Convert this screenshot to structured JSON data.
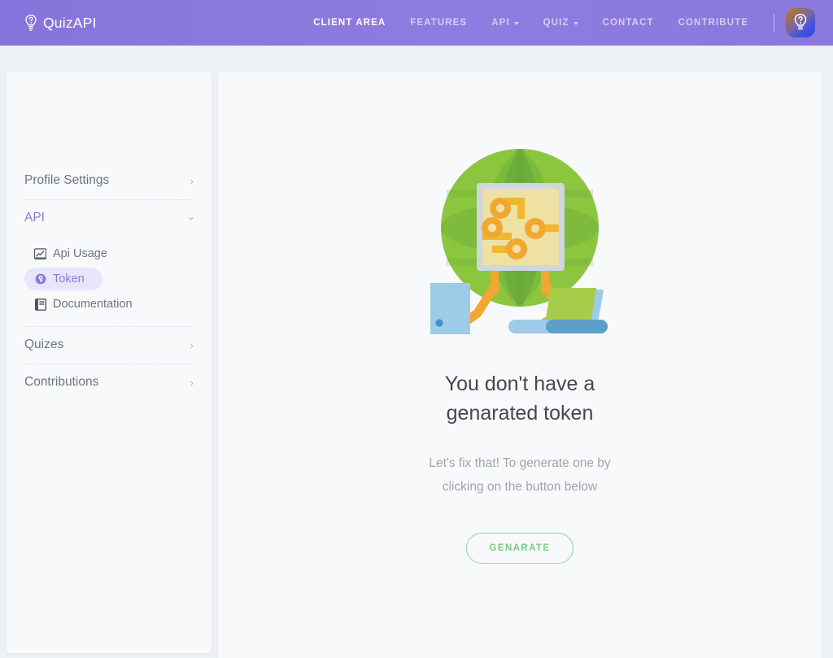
{
  "navbar": {
    "brand": "QuizAPI",
    "brand_icon": "lightbulb-question-icon",
    "avatar_icon": "lightbulb-question-icon",
    "links": [
      {
        "label": "CLIENT AREA",
        "active": true,
        "caret": false,
        "name": "nav-link-client-area"
      },
      {
        "label": "FEATURES",
        "active": false,
        "caret": false,
        "name": "nav-link-features"
      },
      {
        "label": "API",
        "active": false,
        "caret": true,
        "name": "nav-link-api"
      },
      {
        "label": "QUIZ",
        "active": false,
        "caret": true,
        "name": "nav-link-quiz"
      },
      {
        "label": "CONTACT",
        "active": false,
        "caret": false,
        "name": "nav-link-contact"
      },
      {
        "label": "CONTRIBUTE",
        "active": false,
        "caret": false,
        "name": "nav-link-contribute"
      }
    ],
    "brand_color": "#8a78dd",
    "active_link_color": "#ffffff",
    "inactive_link_color": "rgba(255,255,255,0.62)"
  },
  "sidebar": {
    "items": [
      {
        "label": "Profile Settings",
        "state": "collapsed",
        "chevron": "chevron-right-icon"
      },
      {
        "label": "API",
        "state": "expanded",
        "chevron": "chevron-down-icon"
      },
      {
        "label": "Quizes",
        "state": "collapsed",
        "chevron": "chevron-right-icon"
      },
      {
        "label": "Contributions",
        "state": "collapsed",
        "chevron": "chevron-right-icon"
      }
    ],
    "subitems": [
      {
        "label": "Api Usage",
        "icon": "chart-line-icon",
        "active": false
      },
      {
        "label": "Token",
        "icon": "token-key-icon",
        "active": true
      },
      {
        "label": "Documentation",
        "icon": "book-icon",
        "active": false
      }
    ],
    "active_color": "#8a7ae0",
    "text_color": "#6e7480"
  },
  "main": {
    "illustration": "globe-circuit-network-illustration",
    "title_line1": "You don't have a",
    "title_line2": "genarated token",
    "subtitle_line1": "Let's fix that! To generate one by",
    "subtitle_line2": "clicking on the button below",
    "button_label": "GENARATE",
    "button_color": "#79cc85",
    "button_border_color": "#8fd89a"
  },
  "theme": {
    "page_background": "#eef1f4",
    "panel_background": "#f8f9fb",
    "sidebar_background": "#f7f9fb"
  }
}
